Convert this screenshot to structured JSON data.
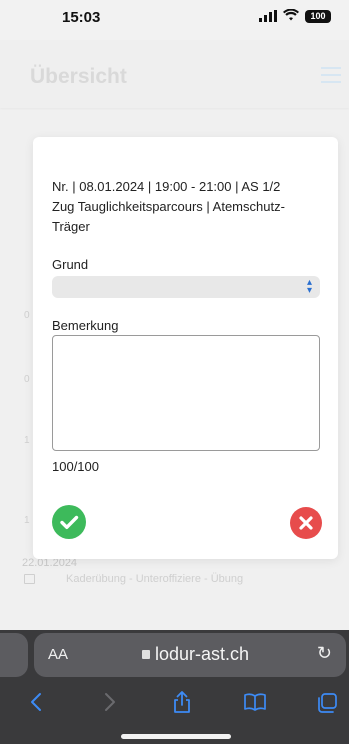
{
  "status_bar": {
    "time": "15:03",
    "battery": "100"
  },
  "page": {
    "title": "Übersicht",
    "bg_date": "22.01.2024",
    "bg_event": "Kaderübung - Unteroffiziere - Übung"
  },
  "modal": {
    "event_line1": "Nr. | 08.01.2024 | 19:00 - 21:00 | AS 1/2",
    "event_line2": "Zug Tauglichkeitsparcours | Atemschutz-",
    "event_line3": "Träger",
    "grund_label": "Grund",
    "grund_value": "",
    "bemerkung_label": "Bemerkung",
    "bemerkung_value": "",
    "counter": "100/100",
    "confirm_icon": "checkmark-icon",
    "cancel_icon": "close-icon"
  },
  "browser": {
    "aa_label": "AA",
    "url": "lodur-ast.ch"
  },
  "colors": {
    "confirm": "#3dba5b",
    "cancel": "#e74c4c",
    "safari_accent": "#3d8bf5"
  }
}
